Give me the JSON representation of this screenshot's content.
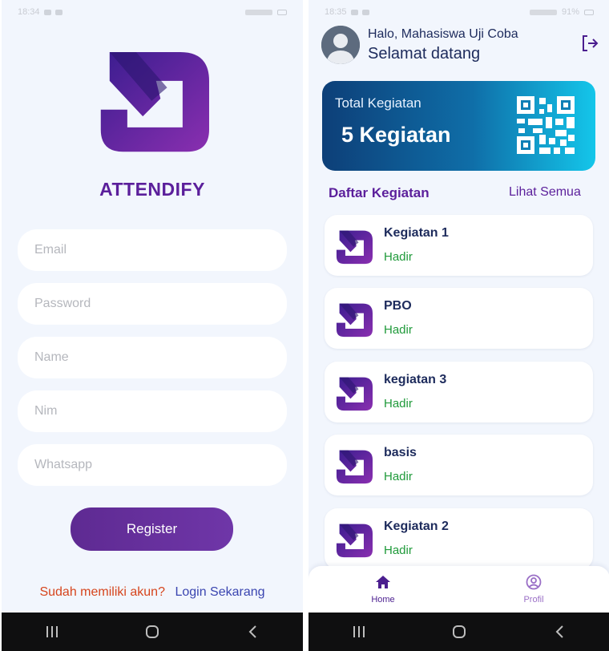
{
  "status_bar": {
    "left_time": "18:34",
    "right_time": "18:35",
    "battery": "91%"
  },
  "register": {
    "app_name": "ATTENDIFY",
    "fields": {
      "email_placeholder": "Email",
      "password_placeholder": "Password",
      "name_placeholder": "Name",
      "nim_placeholder": "Nim",
      "whatsapp_placeholder": "Whatsapp"
    },
    "register_label": "Register",
    "login_prompt": "Sudah memiliki akun?",
    "login_link": "Login Sekarang"
  },
  "home": {
    "greeting": "Halo, Mahasiswa Uji Coba",
    "welcome": "Selamat datang",
    "total_card": {
      "label": "Total Kegiatan",
      "value": "5 Kegiatan"
    },
    "section_title": "Daftar Kegiatan",
    "see_all": "Lihat Semua",
    "items": [
      {
        "title": "Kegiatan 1",
        "status": "Hadir"
      },
      {
        "title": "PBO",
        "status": "Hadir"
      },
      {
        "title": "kegiatan 3",
        "status": "Hadir"
      },
      {
        "title": "basis",
        "status": "Hadir"
      },
      {
        "title": "Kegiatan 2",
        "status": "Hadir"
      }
    ],
    "bottom_nav": {
      "home": "Home",
      "profil": "Profil"
    }
  },
  "colors": {
    "brand_purple": "#5b1f9b",
    "navy_text": "#1d2b5c",
    "status_green": "#1f9a3a",
    "accent_orange": "#d6451d",
    "card_gradient_start": "#0d3f78",
    "card_gradient_end": "#14c6ea"
  },
  "icons": {
    "logo": "attendify-logo-icon",
    "logout": "logout-icon",
    "qr": "qr-code-icon",
    "home": "home-icon",
    "profile": "profile-icon",
    "recent_apps": "recent-apps-icon",
    "home_button": "home-button-icon",
    "back": "back-icon"
  }
}
